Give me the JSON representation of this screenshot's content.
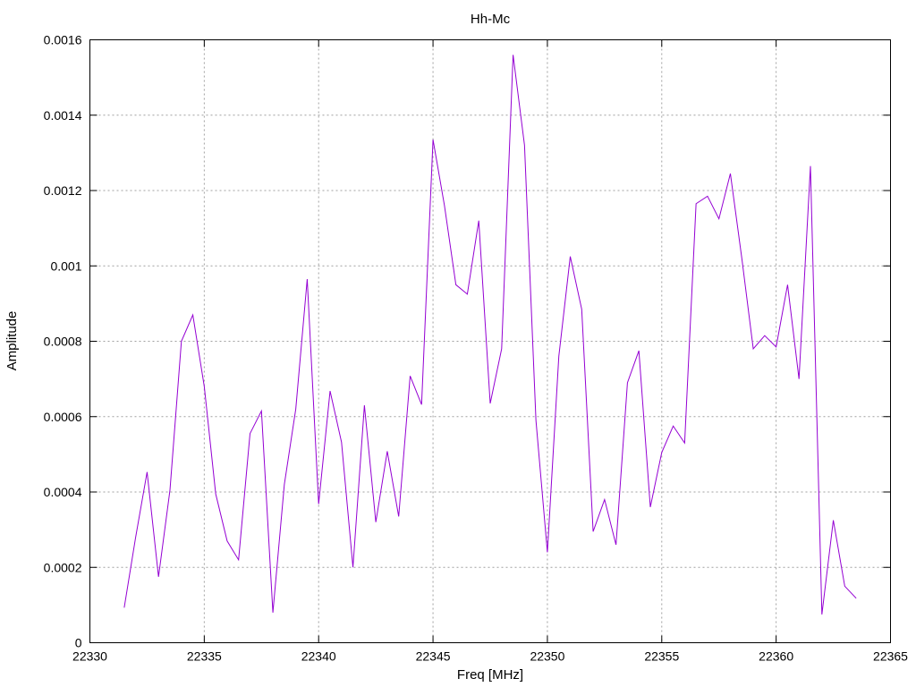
{
  "chart_data": {
    "type": "line",
    "title": "Hh-Mc",
    "xlabel": "Freq [MHz]",
    "ylabel": "Amplitude",
    "xlim": [
      22330,
      22365
    ],
    "ylim": [
      0,
      0.0016
    ],
    "xticks": [
      22330,
      22335,
      22340,
      22345,
      22350,
      22355,
      22360,
      22365
    ],
    "xtick_labels": [
      "22330",
      "22335",
      "22340",
      "22345",
      "22350",
      "22355",
      "22360",
      "22365"
    ],
    "yticks": [
      0,
      0.0002,
      0.0004,
      0.0006,
      0.0008,
      0.001,
      0.0012,
      0.0014,
      0.0016
    ],
    "ytick_labels": [
      "0",
      "0.0002",
      "0.0004",
      "0.0006",
      "0.0008",
      "0.001",
      "0.0012",
      "0.0014",
      "0.0016"
    ],
    "grid": true,
    "series": [
      {
        "color": "#9400d3",
        "x": [
          22331.5,
          22332.0,
          22332.5,
          22333.0,
          22333.5,
          22334.0,
          22334.5,
          22335.0,
          22335.5,
          22336.0,
          22336.5,
          22337.0,
          22337.5,
          22338.0,
          22338.5,
          22339.0,
          22339.5,
          22340.0,
          22340.5,
          22341.0,
          22341.5,
          22342.0,
          22342.5,
          22343.0,
          22343.5,
          22344.0,
          22344.5,
          22345.0,
          22345.5,
          22346.0,
          22346.5,
          22347.0,
          22347.5,
          22348.0,
          22348.5,
          22349.0,
          22349.5,
          22350.0,
          22350.5,
          22351.0,
          22351.5,
          22352.0,
          22352.5,
          22353.0,
          22353.5,
          22354.0,
          22354.5,
          22355.0,
          22355.5,
          22356.0,
          22356.5,
          22357.0,
          22357.5,
          22358.0,
          22358.5,
          22359.0,
          22359.5,
          22360.0,
          22360.5,
          22361.0,
          22361.5,
          22362.0,
          22362.5,
          22363.0,
          22363.5
        ],
        "values": [
          9.3e-05,
          0.00028,
          0.000453,
          0.000175,
          0.000405,
          0.0008,
          0.00087,
          0.00068,
          0.000395,
          0.00027,
          0.00022,
          0.000555,
          0.000615,
          8e-05,
          0.00042,
          0.00062,
          0.000965,
          0.000368,
          0.000668,
          0.000532,
          0.0002,
          0.00063,
          0.00032,
          0.000508,
          0.000335,
          0.000708,
          0.000632,
          0.001335,
          0.00116,
          0.00095,
          0.000925,
          0.00112,
          0.000635,
          0.00078,
          0.00156,
          0.00132,
          0.00059,
          0.00024,
          0.00076,
          0.001025,
          0.000885,
          0.000295,
          0.00038,
          0.00026,
          0.00069,
          0.000775,
          0.00036,
          0.000505,
          0.000575,
          0.00053,
          0.001165,
          0.001185,
          0.001125,
          0.001245,
          0.00102,
          0.00078,
          0.000815,
          0.000785,
          0.00095,
          0.0007,
          0.001265,
          7.5e-05,
          0.000325,
          0.00015,
          0.000118
        ]
      }
    ]
  }
}
